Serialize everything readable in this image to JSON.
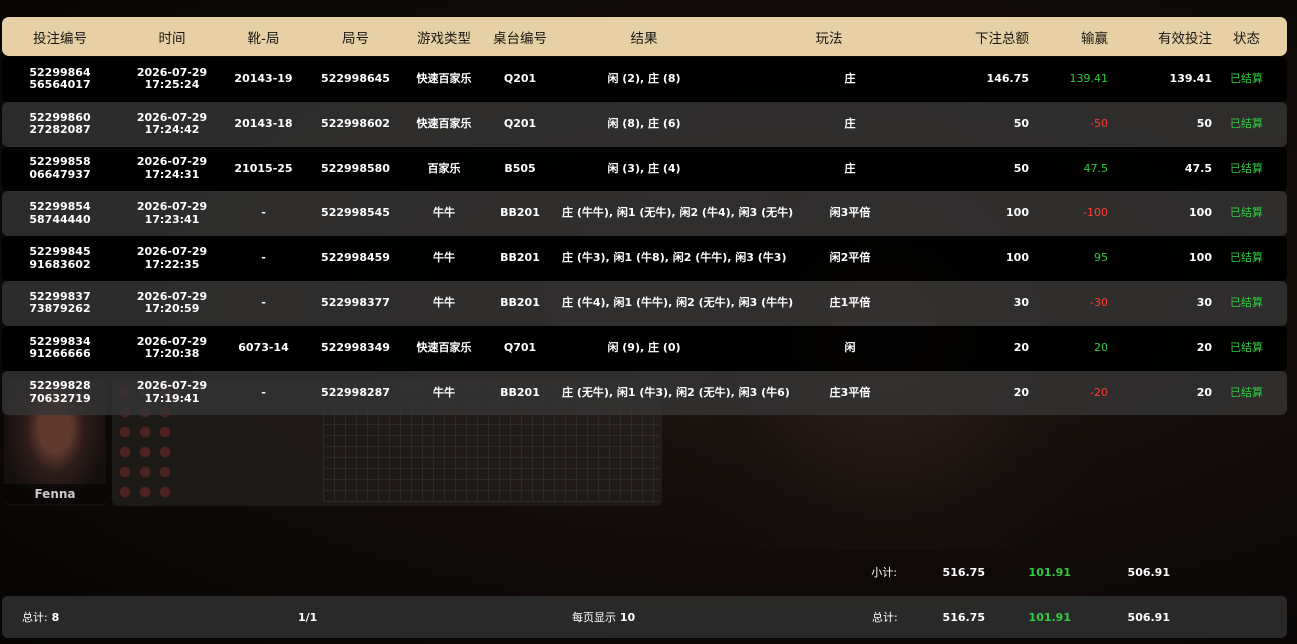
{
  "background": {
    "dealer_name": "Fenna"
  },
  "table": {
    "headers": {
      "bet_id": "投注编号",
      "time": "时间",
      "shoe_round": "靴-局",
      "game_no": "局号",
      "game_type": "游戏类型",
      "table_no": "桌台编号",
      "result": "结果",
      "play": "玩法",
      "bet_total": "下注总额",
      "win_loss": "输赢",
      "valid_bet": "有效投注",
      "status": "状态"
    },
    "rows": [
      {
        "bet_id_1": "52299864",
        "bet_id_2": "56564017",
        "date": "2026-07-29",
        "clock": "17:25:24",
        "shoe_round": "20143-19",
        "game_no": "522998645",
        "game_type": "快速百家乐",
        "table_no": "Q201",
        "result": "闲 (2), 庄 (8)",
        "play": "庄",
        "bet_total": "146.75",
        "win_loss": "139.41",
        "win_sign": "pos",
        "valid_bet": "139.41",
        "status": "已结算"
      },
      {
        "bet_id_1": "52299860",
        "bet_id_2": "27282087",
        "date": "2026-07-29",
        "clock": "17:24:42",
        "shoe_round": "20143-18",
        "game_no": "522998602",
        "game_type": "快速百家乐",
        "table_no": "Q201",
        "result": "闲 (8), 庄 (6)",
        "play": "庄",
        "bet_total": "50",
        "win_loss": "-50",
        "win_sign": "neg",
        "valid_bet": "50",
        "status": "已结算"
      },
      {
        "bet_id_1": "52299858",
        "bet_id_2": "06647937",
        "date": "2026-07-29",
        "clock": "17:24:31",
        "shoe_round": "21015-25",
        "game_no": "522998580",
        "game_type": "百家乐",
        "table_no": "B505",
        "result": "闲 (3), 庄 (4)",
        "play": "庄",
        "bet_total": "50",
        "win_loss": "47.5",
        "win_sign": "pos",
        "valid_bet": "47.5",
        "status": "已结算"
      },
      {
        "bet_id_1": "52299854",
        "bet_id_2": "58744440",
        "date": "2026-07-29",
        "clock": "17:23:41",
        "shoe_round": "-",
        "game_no": "522998545",
        "game_type": "牛牛",
        "table_no": "BB201",
        "result": "庄 (牛牛), 闲1 (无牛), 闲2 (牛4), 闲3 (无牛)",
        "play": "闲3平倍",
        "bet_total": "100",
        "win_loss": "-100",
        "win_sign": "neg",
        "valid_bet": "100",
        "status": "已结算"
      },
      {
        "bet_id_1": "52299845",
        "bet_id_2": "91683602",
        "date": "2026-07-29",
        "clock": "17:22:35",
        "shoe_round": "-",
        "game_no": "522998459",
        "game_type": "牛牛",
        "table_no": "BB201",
        "result": "庄 (牛3), 闲1 (牛8), 闲2 (牛牛), 闲3 (牛3)",
        "play": "闲2平倍",
        "bet_total": "100",
        "win_loss": "95",
        "win_sign": "pos",
        "valid_bet": "100",
        "status": "已结算"
      },
      {
        "bet_id_1": "52299837",
        "bet_id_2": "73879262",
        "date": "2026-07-29",
        "clock": "17:20:59",
        "shoe_round": "-",
        "game_no": "522998377",
        "game_type": "牛牛",
        "table_no": "BB201",
        "result": "庄 (牛4), 闲1 (牛牛), 闲2 (无牛), 闲3 (牛牛)",
        "play": "庄1平倍",
        "bet_total": "30",
        "win_loss": "-30",
        "win_sign": "neg",
        "valid_bet": "30",
        "status": "已结算"
      },
      {
        "bet_id_1": "52299834",
        "bet_id_2": "91266666",
        "date": "2026-07-29",
        "clock": "17:20:38",
        "shoe_round": "6073-14",
        "game_no": "522998349",
        "game_type": "快速百家乐",
        "table_no": "Q701",
        "result": "闲 (9), 庄 (0)",
        "play": "闲",
        "bet_total": "20",
        "win_loss": "20",
        "win_sign": "pos",
        "valid_bet": "20",
        "status": "已结算"
      },
      {
        "bet_id_1": "52299828",
        "bet_id_2": "70632719",
        "date": "2026-07-29",
        "clock": "17:19:41",
        "shoe_round": "-",
        "game_no": "522998287",
        "game_type": "牛牛",
        "table_no": "BB201",
        "result": "庄 (无牛), 闲1 (牛3), 闲2 (无牛), 闲3 (牛6)",
        "play": "庄3平倍",
        "bet_total": "20",
        "win_loss": "-20",
        "win_sign": "neg",
        "valid_bet": "20",
        "status": "已结算"
      }
    ]
  },
  "subtotal": {
    "label": "小计:",
    "bet_total": "516.75",
    "win_loss": "101.91",
    "valid_bet": "506.91"
  },
  "footer": {
    "count_label": "总计:",
    "count": "8",
    "page": "1/1",
    "per_page_label": "每页显示",
    "per_page": "10",
    "total_label": "总计:",
    "bet_total": "516.75",
    "win_loss": "101.91",
    "valid_bet": "506.91"
  },
  "colors": {
    "header_bg": "#e7d0a6",
    "positive": "#2ecc40",
    "negative": "#ff3b30"
  }
}
